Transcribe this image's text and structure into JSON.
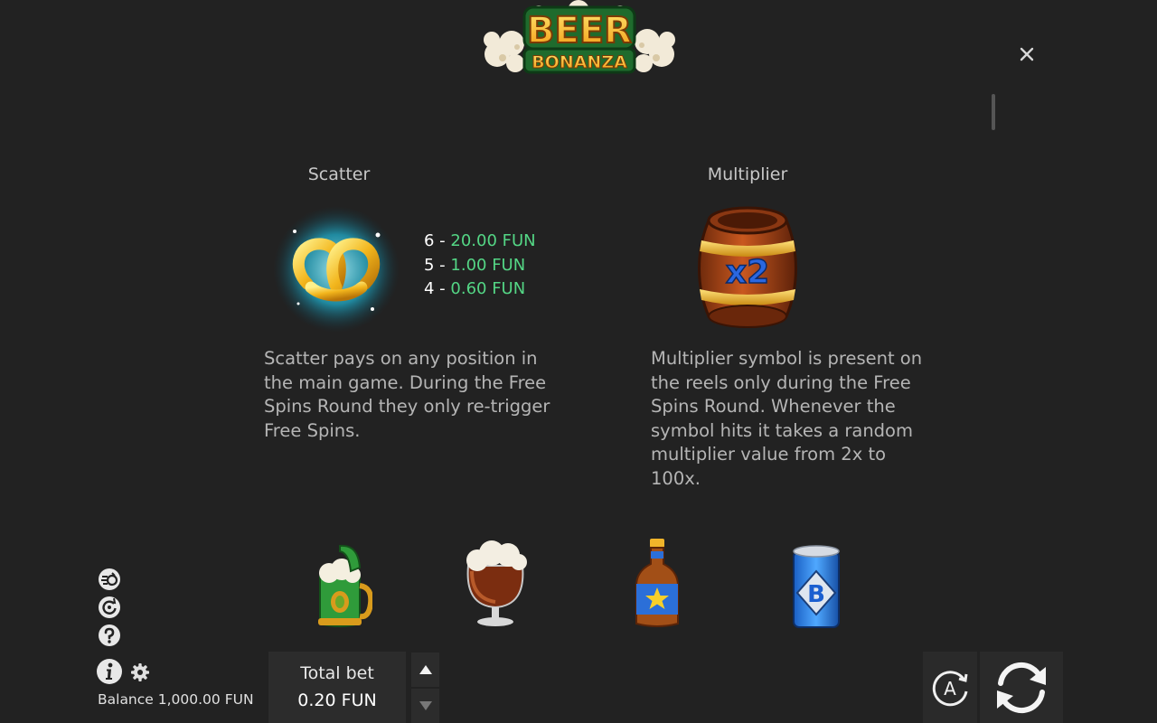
{
  "logo": {
    "line1": "BEER",
    "line2": "BONANZA"
  },
  "close": {
    "icon": "close-icon",
    "label": "×"
  },
  "symbols": {
    "scatter": {
      "title": "Scatter",
      "icon": "pretzel-icon",
      "pays": [
        {
          "count": "6 - ",
          "value": "20.00 FUN"
        },
        {
          "count": "5 - ",
          "value": "1.00 FUN"
        },
        {
          "count": "4 - ",
          "value": "0.60 FUN"
        }
      ],
      "description": "Scatter pays on any position in the main game. During the Free Spins Round they only re-trigger Free Spins."
    },
    "multiplier": {
      "title": "Multiplier",
      "icon": "barrel-icon",
      "badge": "x2",
      "description": "Multiplier symbol is present on the reels only during the Free Spins Round. Whenever the symbol hits it takes a random multiplier value from 2x to 100x."
    }
  },
  "bottom_symbols": [
    "stein-icon",
    "goblet-icon",
    "bottle-icon",
    "can-icon"
  ],
  "can_letter": "B",
  "balance": {
    "text": "Balance 1,000.00 FUN"
  },
  "bet": {
    "label": "Total bet",
    "value": "0.20 FUN"
  },
  "autoplay": {
    "letter": "A"
  },
  "colors": {
    "background": "#222222",
    "win_green": "#54d685",
    "text": "#b5b5b5"
  }
}
